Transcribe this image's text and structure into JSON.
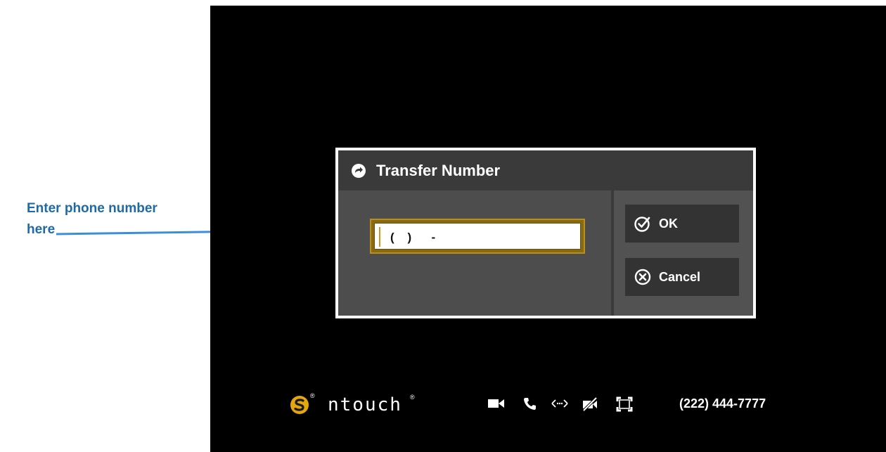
{
  "callout": {
    "line1": "Enter phone number",
    "line2": "here",
    "color": "#1f6aa5"
  },
  "dialog": {
    "title": "Transfer Number",
    "header_icon": "transfer-arrow-icon",
    "phone_input_value": "(    )      -",
    "ok_label": "OK",
    "ok_icon": "check-circle-icon",
    "cancel_label": "Cancel",
    "cancel_icon": "x-circle-icon",
    "accent_color": "#b8901e"
  },
  "footer": {
    "logo_text": "ntouch",
    "logo_mark": "®",
    "logo_icon": "sorenson-s-icon",
    "status_icons": [
      "video-camera-icon",
      "phone-icon",
      "transfer-arrows-icon",
      "privacy-off-icon",
      "fullscreen-icon"
    ],
    "phone_number": "(222) 444-7777"
  }
}
